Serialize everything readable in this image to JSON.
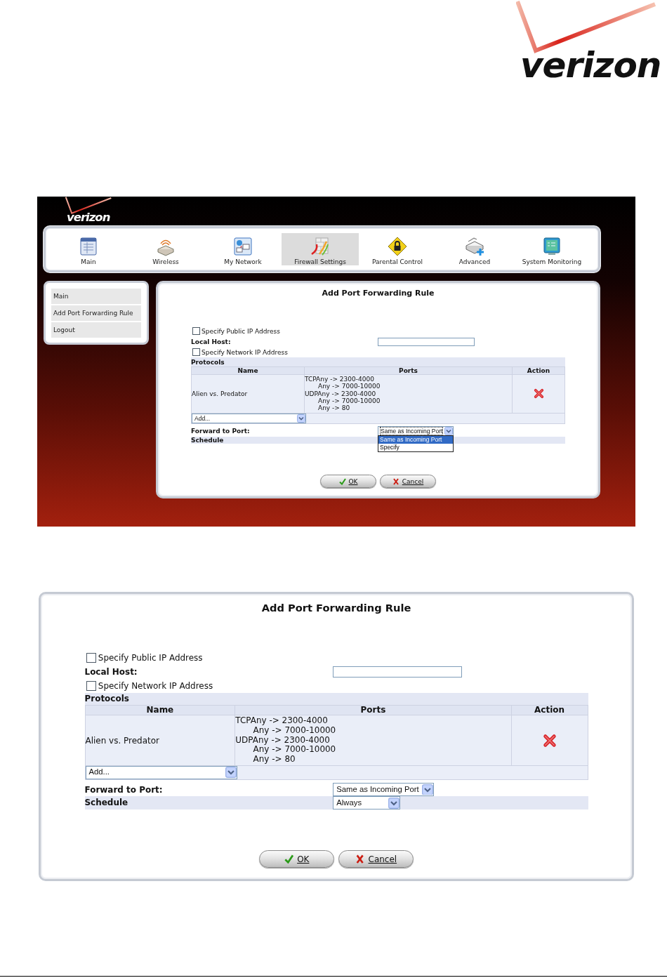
{
  "logo": {
    "text": "verizon"
  },
  "screens": [
    {
      "kind": "full",
      "header": {
        "logo_text": "verizon"
      },
      "nav": [
        {
          "label": "Main",
          "selected": false
        },
        {
          "label": "Wireless",
          "selected": false
        },
        {
          "label": "My Network",
          "selected": false
        },
        {
          "label": "Firewall Settings",
          "selected": true
        },
        {
          "label": "Parental Control",
          "selected": false
        },
        {
          "label": "Advanced",
          "selected": false
        },
        {
          "label": "System Monitoring",
          "selected": false
        }
      ],
      "sidebar": {
        "items": [
          {
            "label": "Main"
          },
          {
            "label": "Add Port Forwarding Rule"
          },
          {
            "label": "Logout"
          }
        ]
      },
      "form": {
        "title": "Add Port Forwarding Rule",
        "public_ip": {
          "label": "Specify Public IP Address",
          "checked": false
        },
        "local_host": {
          "label": "Local Host:"
        },
        "network_ip": {
          "label": "Specify Network IP Address",
          "checked": false
        },
        "protocols": {
          "label": "Protocols",
          "columns": [
            "Name",
            "Ports",
            "Action"
          ],
          "rows": [
            {
              "name": "Alien vs. Predator",
              "ports": [
                {
                  "text": "TCPAny -> 2300-4000",
                  "indented": false
                },
                {
                  "text": "Any -> 7000-10000",
                  "indented": true
                },
                {
                  "text": "UDPAny -> 2300-4000",
                  "indented": false
                },
                {
                  "text": "Any -> 7000-10000",
                  "indented": true
                },
                {
                  "text": "Any -> 80",
                  "indented": true
                }
              ]
            }
          ],
          "add_select": {
            "value": "Add..."
          }
        },
        "forward_to_port": {
          "label": "Forward to Port:",
          "select": {
            "value": "Same as Incoming Port",
            "expanded": true,
            "options": [
              {
                "label": "Same as Incoming Port",
                "selected": true
              },
              {
                "label": "Specify",
                "selected": false
              }
            ]
          }
        },
        "schedule": {
          "label": "Schedule"
        },
        "buttons": [
          {
            "label": "OK",
            "kind": "ok"
          },
          {
            "label": "Cancel",
            "kind": "cancel"
          }
        ]
      }
    },
    {
      "kind": "panel",
      "form": {
        "title": "Add Port Forwarding Rule",
        "public_ip": {
          "label": "Specify Public IP Address",
          "checked": false
        },
        "local_host": {
          "label": "Local Host:"
        },
        "network_ip": {
          "label": "Specify Network IP Address",
          "checked": false
        },
        "protocols": {
          "label": "Protocols",
          "columns": [
            "Name",
            "Ports",
            "Action"
          ],
          "rows": [
            {
              "name": "Alien vs. Predator",
              "ports": [
                {
                  "text": "TCPAny -> 2300-4000",
                  "indented": false
                },
                {
                  "text": "Any -> 7000-10000",
                  "indented": true
                },
                {
                  "text": "UDPAny -> 2300-4000",
                  "indented": false
                },
                {
                  "text": "Any -> 7000-10000",
                  "indented": true
                },
                {
                  "text": "Any -> 80",
                  "indented": true
                }
              ]
            }
          ],
          "add_select": {
            "value": "Add..."
          }
        },
        "forward_to_port": {
          "label": "Forward to Port:",
          "select": {
            "value": "Same as Incoming Port",
            "expanded": false
          }
        },
        "schedule": {
          "label": "Schedule",
          "select": {
            "value": "Always"
          }
        },
        "buttons": [
          {
            "label": "OK",
            "kind": "ok"
          },
          {
            "label": "Cancel",
            "kind": "cancel"
          }
        ]
      }
    }
  ]
}
